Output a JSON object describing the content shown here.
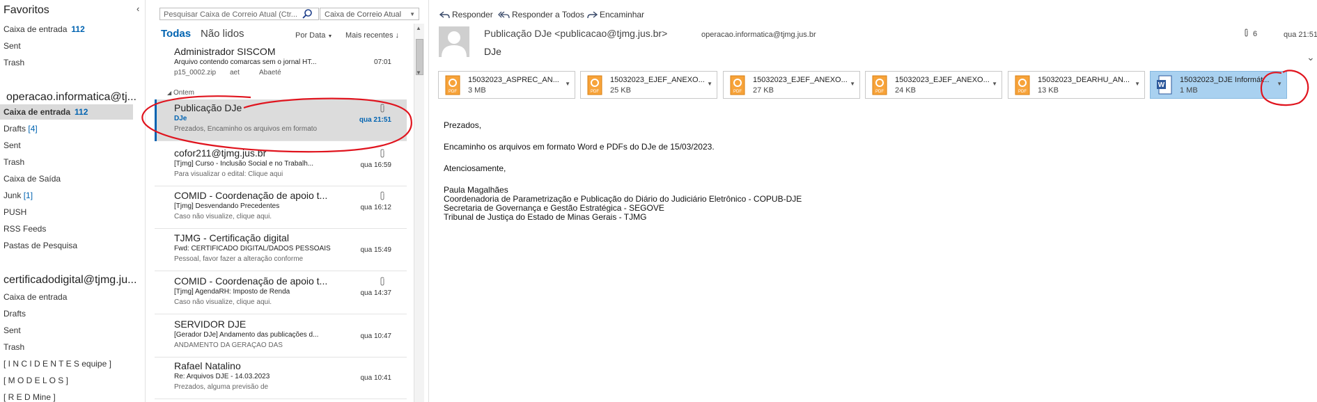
{
  "folders": {
    "favorites_header": "Favoritos",
    "favorites": [
      {
        "label": "Caixa de entrada",
        "count": "112"
      },
      {
        "label": "Sent"
      },
      {
        "label": "Trash"
      }
    ],
    "account1": "operacao.informatica@tj...",
    "account1_items": [
      {
        "label": "Caixa de entrada",
        "count": "112",
        "selected": true
      },
      {
        "label": "Drafts",
        "bracket": "[4]"
      },
      {
        "label": "Sent"
      },
      {
        "label": "Trash"
      },
      {
        "label": "Caixa de Saída"
      },
      {
        "label": "Junk",
        "bracket": "[1]"
      },
      {
        "label": "PUSH"
      },
      {
        "label": "RSS Feeds"
      },
      {
        "label": "Pastas de Pesquisa"
      }
    ],
    "account2": "certificadodigital@tjmg.ju...",
    "account2_items": [
      {
        "label": "Caixa de entrada"
      },
      {
        "label": "Drafts"
      },
      {
        "label": "Sent"
      },
      {
        "label": "Trash"
      },
      {
        "label": "[ I N C I D E N T E S equipe ]"
      },
      {
        "label": "[ M O D E L O S ]"
      },
      {
        "label": "[ R E D Mine ]"
      }
    ]
  },
  "list": {
    "search_placeholder": "Pesquisar Caixa de Correio Atual (Ctr...",
    "scope": "Caixa de Correio Atual",
    "tab_all": "Todas",
    "tab_unread": "Não lidos",
    "sort_by": "Por Data",
    "sort_order": "Mais recentes",
    "group_yesterday": "Ontem",
    "first_message": {
      "from": "Administrador SISCOM",
      "subject": "Arquivo contendo comarcas sem o jornal HT...",
      "time": "07:01",
      "extra1": "p15_0002.zip",
      "extra2": "aet",
      "extra3": "Abaeté"
    },
    "messages": [
      {
        "from": "Publicação DJe",
        "subject": "DJe",
        "preview": "Prezados,  Encaminho os arquivos em formato",
        "time": "qua 21:51",
        "attachment": true,
        "selected": true
      },
      {
        "from": "cofor211@tjmg.jus.br",
        "subject": "[Tjmg] Curso -  Inclusão Social e no Trabalh...",
        "preview": "Para visualizar o edital: Clique aqui",
        "time": "qua 16:59",
        "attachment": true
      },
      {
        "from": "COMID - Coordenação de apoio t...",
        "subject": "[Tjmg] Desvendando Precedentes",
        "preview": "Caso não visualize, clique aqui.",
        "time": "qua 16:12",
        "attachment": true
      },
      {
        "from": "TJMG - Certificação digital",
        "subject": "Fwd: CERTIFICADO DIGITAL/DADOS PESSOAIS",
        "preview": "Pessoal,  favor fazer a alteração conforme",
        "time": "qua 15:49",
        "attachment": false
      },
      {
        "from": "COMID - Coordenação de apoio t...",
        "subject": "[Tjmg] AgendaRH: Imposto de Renda",
        "preview": "Caso não visualize, clique aqui.",
        "time": "qua 14:37",
        "attachment": true
      },
      {
        "from": "SERVIDOR DJE",
        "subject": "[Gerador DJe] Andamento das publicações d...",
        "preview": "ANDAMENTO DA GERAÇÃO DAS",
        "time": "qua 10:47",
        "attachment": false
      },
      {
        "from": "Rafael Natalino",
        "subject": "Re: Arquivos DJE - 14.03.2023",
        "preview": "Prezados, alguma previsão de",
        "time": "qua 10:41",
        "attachment": false
      }
    ]
  },
  "reading": {
    "actions": [
      "Responder",
      "Responder a Todos",
      "Encaminhar"
    ],
    "sender": "Publicação DJe <publicacao@tjmg.jus.br>",
    "to": "operacao.informatica@tjmg.jus.br",
    "attachment_count": "6",
    "date": "qua 21:51",
    "subject": "DJe",
    "attachments": [
      {
        "name": "15032023_ASPREC_AN...",
        "size": "3 MB",
        "type": "pdf"
      },
      {
        "name": "15032023_EJEF_ANEXO...",
        "size": "25 KB",
        "type": "pdf"
      },
      {
        "name": "15032023_EJEF_ANEXO...",
        "size": "27 KB",
        "type": "pdf"
      },
      {
        "name": "15032023_EJEF_ANEXO...",
        "size": "24 KB",
        "type": "pdf"
      },
      {
        "name": "15032023_DEARHU_AN...",
        "size": "13 KB",
        "type": "pdf"
      },
      {
        "name": "15032023_DJE Informát...",
        "size": "1 MB",
        "type": "word",
        "selected": true
      }
    ],
    "body": {
      "greeting": "Prezados,",
      "line1": "Encaminho os arquivos em formato Word e PDFs do DJe de 15/03/2023.",
      "closing": "Atenciosamente,",
      "signature": [
        "Paula Magalhães",
        "Coordenadoria de Parametrização e Publicação do Diário do Judiciário Eletrônico - COPUB-DJE",
        "Secretaria de Governança e Gestão Estratégica - SEGOVE",
        "Tribunal de Justiça do Estado de Minas Gerais - TJMG"
      ]
    }
  },
  "colors": {
    "accent": "#0063b1",
    "annotation": "#e0141e",
    "selected_attachment": "#a9d1f0"
  },
  "icons": [
    "collapse-icon",
    "search-icon",
    "paperclip-icon",
    "reply-icon",
    "reply-all-icon",
    "forward-icon",
    "pdf-file-icon",
    "word-file-icon",
    "dropdown-icon",
    "scroll-arrow-icon"
  ]
}
